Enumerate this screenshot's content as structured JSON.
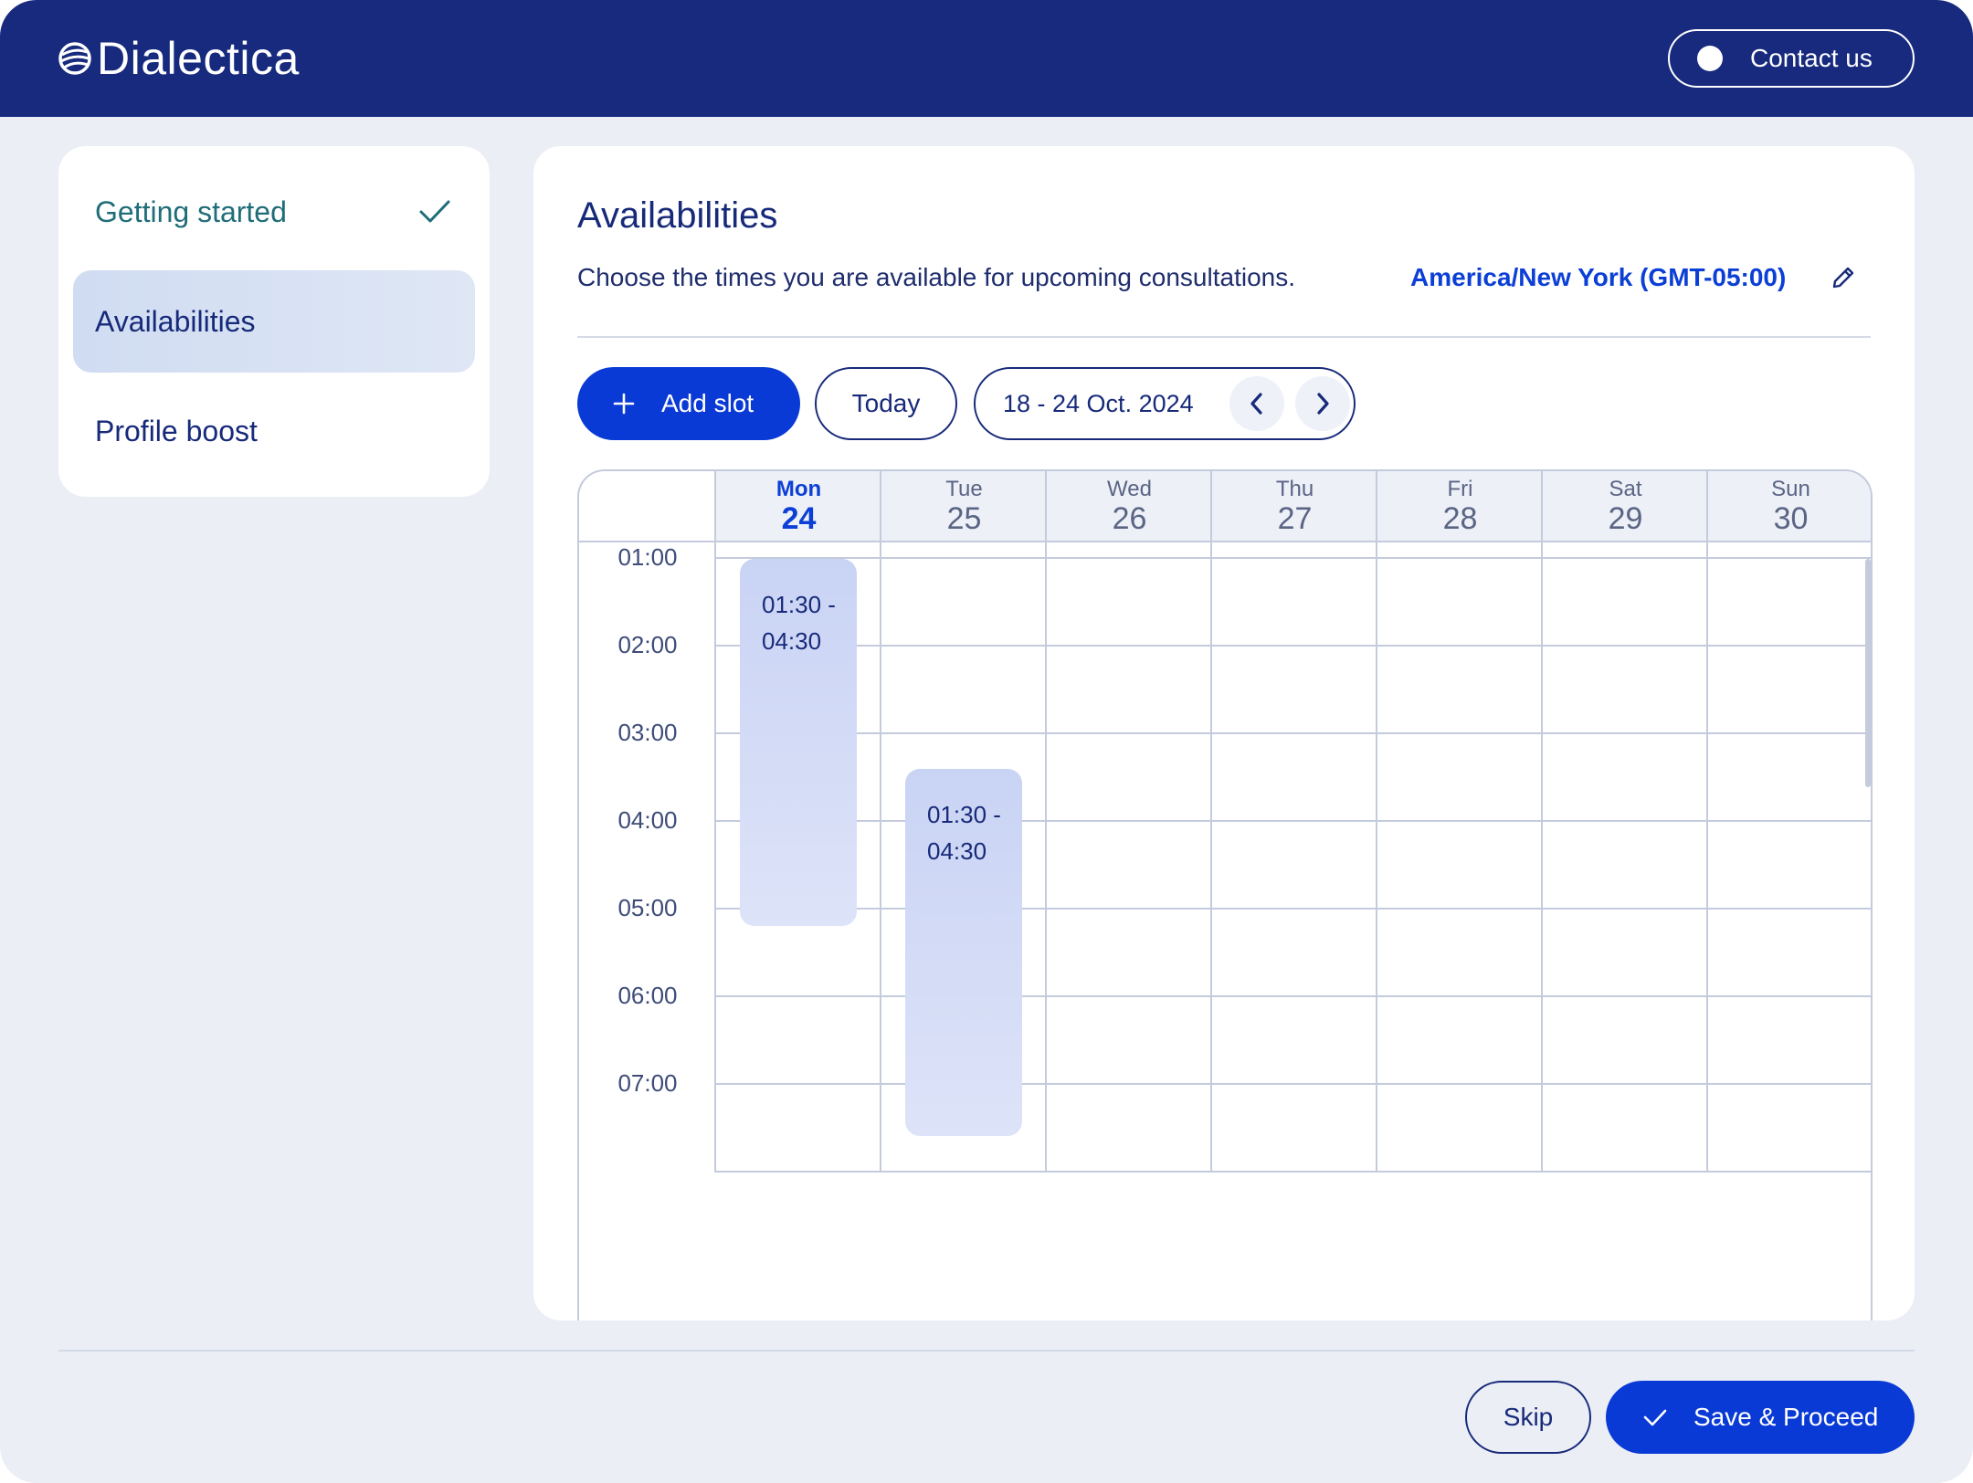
{
  "header": {
    "brand": "Dialectica",
    "contact_label": "Contact us"
  },
  "sidebar": {
    "items": [
      {
        "label": "Getting started",
        "state": "completed"
      },
      {
        "label": "Availabilities",
        "state": "active"
      },
      {
        "label": "Profile boost",
        "state": "default"
      }
    ]
  },
  "main": {
    "title": "Availabilities",
    "subtitle": "Choose the times you are available for upcoming consultations.",
    "timezone": "America/New York (GMT-05:00)",
    "toolbar": {
      "add_label": "Add slot",
      "today_label": "Today",
      "range_label": "18 - 24 Oct. 2024"
    },
    "calendar": {
      "days": [
        {
          "name": "Mon",
          "num": "24",
          "today": true
        },
        {
          "name": "Tue",
          "num": "25",
          "today": false
        },
        {
          "name": "Wed",
          "num": "26",
          "today": false
        },
        {
          "name": "Thu",
          "num": "27",
          "today": false
        },
        {
          "name": "Fri",
          "num": "28",
          "today": false
        },
        {
          "name": "Sat",
          "num": "29",
          "today": false
        },
        {
          "name": "Sun",
          "num": "30",
          "today": false
        }
      ],
      "times": [
        "01:00",
        "02:00",
        "03:00",
        "04:00",
        "05:00",
        "06:00",
        "07:00"
      ],
      "slots": [
        {
          "day": "Mon",
          "start": "01:30",
          "end": "04:30",
          "line1": "01:30 -",
          "line2": "04:30"
        },
        {
          "day": "Tue",
          "start": "01:30",
          "end": "04:30",
          "line1": "01:30 -",
          "line2": "04:30"
        }
      ]
    }
  },
  "footer": {
    "skip_label": "Skip",
    "save_label": "Save & Proceed"
  },
  "colors": {
    "brand_navy": "#172a7e",
    "primary_blue": "#0a3ad6",
    "completed_teal": "#1f6d79",
    "slot_fill": "#c9d3f4"
  },
  "icons": [
    "logo-mark-icon",
    "contact-dot-icon",
    "check-icon",
    "edit-pencil-icon",
    "plus-icon",
    "chevron-left-icon",
    "chevron-right-icon"
  ]
}
